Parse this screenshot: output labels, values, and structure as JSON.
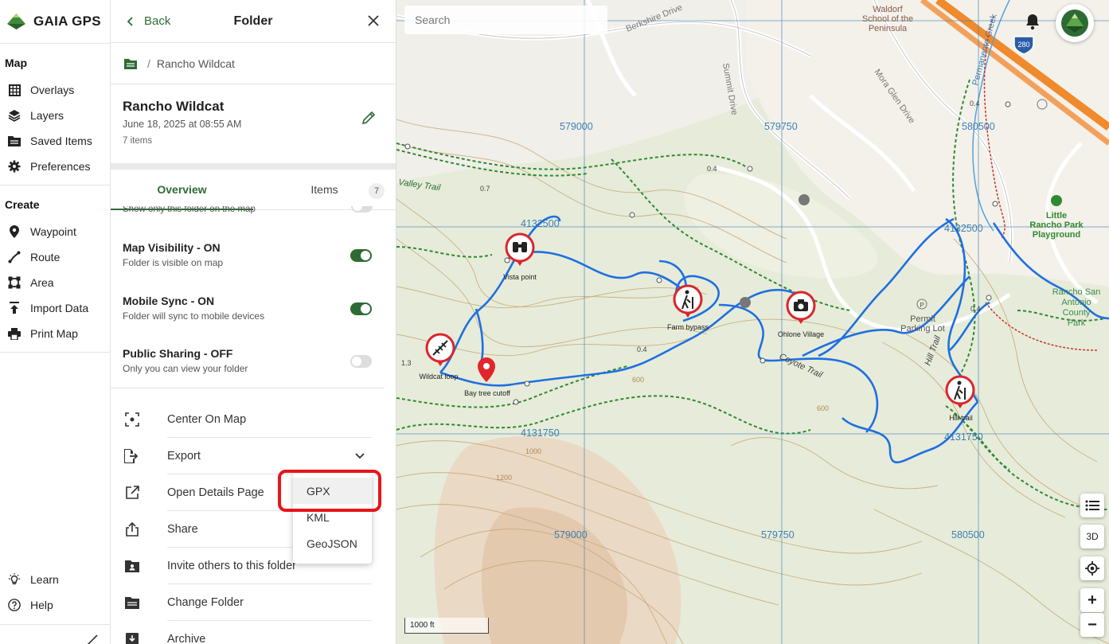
{
  "app": {
    "brand": "GAIA GPS"
  },
  "nav": {
    "map_section": "Map",
    "map_items": [
      {
        "label": "Overlays",
        "icon": "overlays-icon"
      },
      {
        "label": "Layers",
        "icon": "layers-icon"
      },
      {
        "label": "Saved Items",
        "icon": "saved-items-icon"
      },
      {
        "label": "Preferences",
        "icon": "gear-icon"
      }
    ],
    "create_section": "Create",
    "create_items": [
      {
        "label": "Waypoint",
        "icon": "pin-icon"
      },
      {
        "label": "Route",
        "icon": "route-icon"
      },
      {
        "label": "Area",
        "icon": "area-icon"
      },
      {
        "label": "Import Data",
        "icon": "upload-icon"
      },
      {
        "label": "Print Map",
        "icon": "printer-icon"
      }
    ],
    "bottom_items": [
      {
        "label": "Learn",
        "icon": "lightbulb-icon"
      },
      {
        "label": "Help",
        "icon": "help-icon"
      }
    ]
  },
  "panel": {
    "back_label": "Back",
    "title": "Folder",
    "breadcrumb_separator": "/",
    "breadcrumb": "Rancho Wildcat",
    "folder_name": "Rancho Wildcat",
    "folder_date": "June 18, 2025 at 08:55 AM",
    "folder_count": "7 items",
    "tabs": [
      {
        "label": "Overview",
        "active": true
      },
      {
        "label": "Items",
        "badge": "7"
      }
    ],
    "cutoff_text": "Show only this folder on the map",
    "settings": [
      {
        "title": "Map Visibility - ON",
        "desc": "Folder is visible on map",
        "on": true
      },
      {
        "title": "Mobile Sync - ON",
        "desc": "Folder will sync to mobile devices",
        "on": true
      },
      {
        "title": "Public Sharing - OFF",
        "desc": "Only you can view your folder",
        "on": false
      }
    ],
    "actions": [
      {
        "label": "Center On Map",
        "icon": "center-focus-icon"
      },
      {
        "label": "Export",
        "icon": "export-icon"
      },
      {
        "label": "Open Details Page",
        "icon": "external-link-icon"
      },
      {
        "label": "Share",
        "icon": "share-icon"
      },
      {
        "label": "Invite others to this folder",
        "icon": "invite-icon"
      },
      {
        "label": "Change Folder",
        "icon": "folder-icon"
      },
      {
        "label": "Archive",
        "icon": "archive-icon"
      }
    ],
    "export_options": [
      "GPX",
      "KML",
      "GeoJSON"
    ],
    "export_selected": "GPX"
  },
  "map": {
    "search_placeholder": "Search",
    "scale_label": "1000 ft",
    "buttons": {
      "legend": "legend-icon",
      "three_d": "3D",
      "locate": "locate-icon",
      "zoom_in": "+",
      "zoom_out": "−"
    },
    "place_labels": {
      "school": [
        "Waldorf",
        "School of the",
        "Peninsula"
      ],
      "playground": [
        "Little",
        "Rancho Park",
        "Playground"
      ],
      "county_park": [
        "Rancho San",
        "Antonio",
        "County",
        "Park"
      ],
      "parking": [
        "Permit",
        "Parking Lot"
      ]
    },
    "road_labels": [
      "Berkshire Drive",
      "Summit Drive",
      "Mora Glen Drive",
      "Permanente Creek"
    ],
    "trail_labels": [
      "Valley Trail",
      "Coyote Trail",
      "Hill Trail"
    ],
    "highway_label": "280",
    "grid_labels": [
      "579000",
      "579750",
      "580500",
      "4132500",
      "4131750"
    ],
    "distance_labels": [
      "0.4",
      "0.7",
      "0.4",
      "0.4",
      "0.4",
      "1.3"
    ],
    "contour_labels": [
      "600",
      "600",
      "1000",
      "1200"
    ],
    "waypoints": [
      {
        "label": "Vista point",
        "icon": "binoculars-icon"
      },
      {
        "label": "Farm bypass",
        "icon": "hiker-icon"
      },
      {
        "label": "Ohlone Village",
        "icon": "camera-icon"
      },
      {
        "label": "Wildcat loop",
        "icon": "stairs-icon"
      },
      {
        "label": "Bay tree cutoff",
        "icon": "map-pin-icon"
      },
      {
        "label": "Hill trail",
        "icon": "hiker-icon"
      }
    ],
    "colors": {
      "route": "#1f6fe0",
      "trail": "#2f8a2f",
      "contour": "#c9a97a",
      "grid": "#3f7fb5",
      "highway": "#f08a2c",
      "brand_green": "#2e6b34"
    }
  }
}
